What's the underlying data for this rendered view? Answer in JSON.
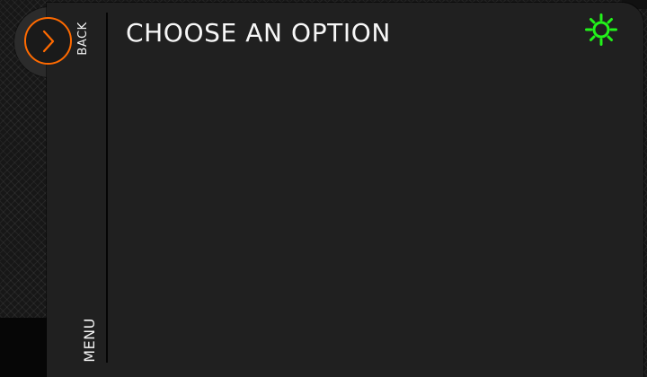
{
  "header": {
    "title": "CHOOSE AN OPTION"
  },
  "sidebar": {
    "back_label": "BACK",
    "menu_label": "MENU"
  },
  "icons": {
    "back": "chevron-right-icon",
    "status": "sun-icon"
  },
  "colors": {
    "background": "#171717",
    "panel": "#202020",
    "text": "#f7f7f7",
    "accent_orange": "#ff6a00",
    "accent_green": "#22f21a"
  }
}
